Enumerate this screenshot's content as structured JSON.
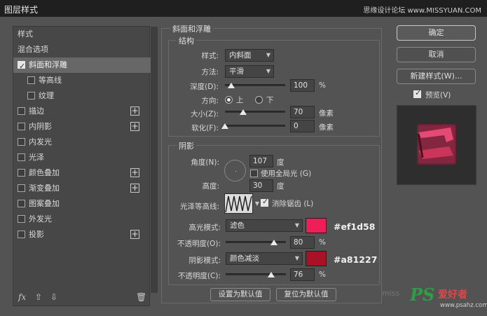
{
  "window": {
    "title": "图层样式",
    "watermark": "思缘设计论坛 www.MISSYUAN.COM"
  },
  "sidebar": {
    "items": [
      {
        "label": "样式",
        "checkbox": false,
        "plus": false,
        "selected": false
      },
      {
        "label": "混合选项",
        "checkbox": false,
        "plus": false,
        "selected": false
      },
      {
        "label": "斜面和浮雕",
        "checkbox": true,
        "checked": true,
        "plus": false,
        "selected": true
      },
      {
        "label": "等高线",
        "checkbox": true,
        "checked": false,
        "plus": false,
        "selected": false,
        "sub": true
      },
      {
        "label": "纹理",
        "checkbox": true,
        "checked": false,
        "plus": false,
        "selected": false,
        "sub": true
      },
      {
        "label": "描边",
        "checkbox": true,
        "checked": false,
        "plus": true,
        "selected": false
      },
      {
        "label": "内阴影",
        "checkbox": true,
        "checked": false,
        "plus": true,
        "selected": false
      },
      {
        "label": "内发光",
        "checkbox": true,
        "checked": false,
        "plus": false,
        "selected": false
      },
      {
        "label": "光泽",
        "checkbox": true,
        "checked": false,
        "plus": false,
        "selected": false
      },
      {
        "label": "颜色叠加",
        "checkbox": true,
        "checked": false,
        "plus": true,
        "selected": false
      },
      {
        "label": "渐变叠加",
        "checkbox": true,
        "checked": false,
        "plus": true,
        "selected": false
      },
      {
        "label": "图案叠加",
        "checkbox": true,
        "checked": false,
        "plus": false,
        "selected": false
      },
      {
        "label": "外发光",
        "checkbox": true,
        "checked": false,
        "plus": false,
        "selected": false
      },
      {
        "label": "投影",
        "checkbox": true,
        "checked": false,
        "plus": true,
        "selected": false
      }
    ],
    "bottom": {
      "fx": "fx",
      "up": "⇧",
      "down": "⇩",
      "trash": "🗑"
    }
  },
  "bevel": {
    "section_title": "斜面和浮雕",
    "structure": {
      "title": "结构",
      "style_label": "样式:",
      "style_value": "内斜面",
      "technique_label": "方法:",
      "technique_value": "平滑",
      "depth_label": "深度(D):",
      "depth_value": "100",
      "depth_unit": "%",
      "direction_label": "方向:",
      "dir_up": "上",
      "dir_down": "下",
      "size_label": "大小(Z):",
      "size_value": "70",
      "size_unit": "像素",
      "soften_label": "软化(F):",
      "soften_value": "0",
      "soften_unit": "像素"
    },
    "shading": {
      "title": "阴影",
      "angle_label": "角度(N):",
      "angle_value": "107",
      "angle_unit": "度",
      "global_light_label": "使用全局光 (G)",
      "altitude_label": "高度:",
      "altitude_value": "30",
      "altitude_unit": "度",
      "gloss_label": "光泽等高线:",
      "antialias_label": "消除锯齿 (L)",
      "highlight_label": "高光模式:",
      "highlight_value": "滤色",
      "highlight_color": "#ef1d58",
      "highlight_opacity_label": "不透明度(O):",
      "highlight_opacity": "80",
      "highlight_opacity_unit": "%",
      "shadow_label": "阴影模式:",
      "shadow_value": "颜色减淡",
      "shadow_color": "#a81227",
      "shadow_opacity_label": "不透明度(C):",
      "shadow_opacity": "76",
      "shadow_opacity_unit": "%",
      "highlight_hex_note": "#ef1d58",
      "shadow_hex_note": "#a81227"
    },
    "make_default": "设置为默认值",
    "reset_default": "复位为默认值"
  },
  "levels": {
    "depth": 0.1,
    "size": 0.3,
    "soften": 0.0,
    "highlight_opacity": 0.8,
    "shadow_opacity": 0.76
  },
  "right": {
    "ok": "确定",
    "cancel": "取消",
    "new_style": "新建样式(W)...",
    "preview_label": "预览(V)",
    "preview_checked": true
  },
  "brand": {
    "ps": "PS",
    "cn": "爱好者",
    "url": "www.psahz.com",
    "ghost": "miss"
  }
}
